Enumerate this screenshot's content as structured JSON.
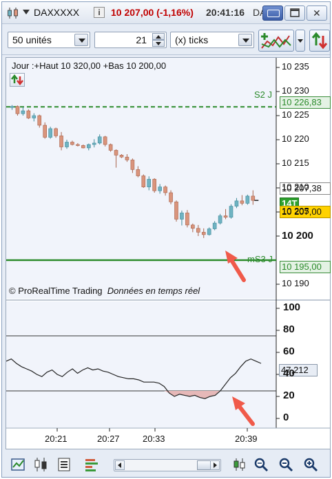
{
  "titlebar": {
    "symbol": "DAXXXXX",
    "info_glyph": "i",
    "price_change": "10 207,00 (-1,16%)",
    "time": "20:41:16",
    "truncated_text": "DA",
    "close_glyph": "✕"
  },
  "toolbar": {
    "units_value": "50 unités",
    "ticks_count": "21",
    "ticks_mode": "(x) ticks"
  },
  "chart": {
    "info_line": "Jour :+Haut 10 320,00 +Bas 10 200,00",
    "copyright": "© ProRealTime Trading",
    "realtime": "Données en temps réel",
    "s2_label": "S2 J",
    "s2_value": "10 226,83",
    "ms3_label": "mS3 J",
    "ms3_value": "10 195,00",
    "last_value": "10 207,38",
    "tick_count_tag": "14T",
    "price_tag": "10 207,00",
    "price_ticks": [
      "10 235",
      "10 230",
      "10 225",
      "10 220",
      "10 215",
      "10 210",
      "10 205",
      "10 200",
      "10 190"
    ],
    "osc_ticks": [
      "100",
      "80",
      "60",
      "40",
      "20",
      "0"
    ],
    "osc_value": "47,212",
    "time_ticks": [
      "20:21",
      "20:27",
      "20:33",
      "20:39"
    ],
    "colors": {
      "up": "#6fb3c2",
      "down": "#d9947c",
      "level": "#2a8a2a",
      "arrow": "#f05a4a"
    }
  },
  "chart_data": {
    "type": "candlestick",
    "price_ylim": [
      10187,
      10237
    ],
    "levels": [
      {
        "name": "S2 J",
        "value": 10226.83
      },
      {
        "name": "mS3 J",
        "value": 10195.0
      }
    ],
    "candles": [
      {
        "o": 10226.8,
        "h": 10227.2,
        "l": 10226.2,
        "c": 10226.9
      },
      {
        "o": 10226.9,
        "h": 10227.1,
        "l": 10225.0,
        "c": 10225.4
      },
      {
        "o": 10225.4,
        "h": 10226.8,
        "l": 10225.0,
        "c": 10226.0
      },
      {
        "o": 10226.0,
        "h": 10226.3,
        "l": 10224.3,
        "c": 10224.5
      },
      {
        "o": 10224.5,
        "h": 10225.5,
        "l": 10223.8,
        "c": 10225.0
      },
      {
        "o": 10225.0,
        "h": 10225.2,
        "l": 10222.5,
        "c": 10223.0
      },
      {
        "o": 10223.0,
        "h": 10223.6,
        "l": 10220.2,
        "c": 10220.5
      },
      {
        "o": 10220.5,
        "h": 10222.7,
        "l": 10220.2,
        "c": 10222.3
      },
      {
        "o": 10222.3,
        "h": 10222.5,
        "l": 10220.4,
        "c": 10220.8
      },
      {
        "o": 10220.8,
        "h": 10221.6,
        "l": 10217.8,
        "c": 10218.5
      },
      {
        "o": 10218.5,
        "h": 10220.0,
        "l": 10218.1,
        "c": 10219.5
      },
      {
        "o": 10219.5,
        "h": 10219.8,
        "l": 10218.8,
        "c": 10219.0
      },
      {
        "o": 10219.0,
        "h": 10219.3,
        "l": 10218.6,
        "c": 10218.8
      },
      {
        "o": 10218.8,
        "h": 10219.0,
        "l": 10218.2,
        "c": 10218.3
      },
      {
        "o": 10218.3,
        "h": 10219.2,
        "l": 10217.8,
        "c": 10219.0
      },
      {
        "o": 10219.0,
        "h": 10220.1,
        "l": 10218.4,
        "c": 10219.3
      },
      {
        "o": 10219.3,
        "h": 10221.1,
        "l": 10219.0,
        "c": 10220.6
      },
      {
        "o": 10220.6,
        "h": 10220.8,
        "l": 10218.6,
        "c": 10219.0
      },
      {
        "o": 10219.0,
        "h": 10219.2,
        "l": 10217.5,
        "c": 10217.8
      },
      {
        "o": 10217.8,
        "h": 10218.0,
        "l": 10214.2,
        "c": 10216.8
      },
      {
        "o": 10216.8,
        "h": 10217.0,
        "l": 10216.2,
        "c": 10216.4
      },
      {
        "o": 10216.4,
        "h": 10217.0,
        "l": 10215.4,
        "c": 10215.8
      },
      {
        "o": 10215.8,
        "h": 10216.1,
        "l": 10213.1,
        "c": 10213.8
      },
      {
        "o": 10213.8,
        "h": 10214.5,
        "l": 10212.2,
        "c": 10212.5
      },
      {
        "o": 10212.5,
        "h": 10212.8,
        "l": 10210.0,
        "c": 10210.2
      },
      {
        "o": 10210.2,
        "h": 10212.4,
        "l": 10209.5,
        "c": 10211.8
      },
      {
        "o": 10211.8,
        "h": 10212.0,
        "l": 10209.0,
        "c": 10209.4
      },
      {
        "o": 10209.4,
        "h": 10210.8,
        "l": 10208.8,
        "c": 10210.2
      },
      {
        "o": 10210.2,
        "h": 10210.5,
        "l": 10208.4,
        "c": 10209.0
      },
      {
        "o": 10209.0,
        "h": 10209.5,
        "l": 10206.6,
        "c": 10207.1
      },
      {
        "o": 10207.1,
        "h": 10207.4,
        "l": 10203.0,
        "c": 10203.5
      },
      {
        "o": 10203.5,
        "h": 10205.3,
        "l": 10202.2,
        "c": 10204.8
      },
      {
        "o": 10204.8,
        "h": 10205.4,
        "l": 10201.8,
        "c": 10202.3
      },
      {
        "o": 10202.3,
        "h": 10202.6,
        "l": 10200.8,
        "c": 10201.6
      },
      {
        "o": 10201.6,
        "h": 10202.3,
        "l": 10200.0,
        "c": 10200.8
      },
      {
        "o": 10200.8,
        "h": 10201.6,
        "l": 10199.6,
        "c": 10200.3
      },
      {
        "o": 10200.3,
        "h": 10201.8,
        "l": 10200.1,
        "c": 10201.5
      },
      {
        "o": 10201.5,
        "h": 10203.1,
        "l": 10201.2,
        "c": 10202.7
      },
      {
        "o": 10202.7,
        "h": 10204.6,
        "l": 10202.4,
        "c": 10204.2
      },
      {
        "o": 10204.2,
        "h": 10205.6,
        "l": 10203.5,
        "c": 10203.9
      },
      {
        "o": 10203.9,
        "h": 10206.6,
        "l": 10203.6,
        "c": 10206.2
      },
      {
        "o": 10206.2,
        "h": 10207.9,
        "l": 10205.8,
        "c": 10207.3
      },
      {
        "o": 10207.3,
        "h": 10208.5,
        "l": 10206.4,
        "c": 10206.8
      },
      {
        "o": 10206.8,
        "h": 10208.6,
        "l": 10206.5,
        "c": 10208.3
      },
      {
        "o": 10208.3,
        "h": 10209.5,
        "l": 10206.5,
        "c": 10207.4
      }
    ],
    "oscillator": {
      "ylim": [
        -5,
        105
      ],
      "levels": [
        75,
        25
      ],
      "values": [
        52,
        54,
        50,
        47,
        45,
        43,
        40,
        38,
        42,
        44,
        40,
        38,
        42,
        45,
        41,
        44,
        46,
        44,
        45,
        43,
        42,
        40,
        38,
        37,
        36,
        36,
        35,
        33,
        33,
        33,
        32,
        29,
        23,
        20,
        22,
        21,
        20,
        21,
        19,
        18,
        20,
        21,
        25,
        31,
        37,
        41,
        47,
        52,
        54,
        52,
        50
      ]
    }
  }
}
